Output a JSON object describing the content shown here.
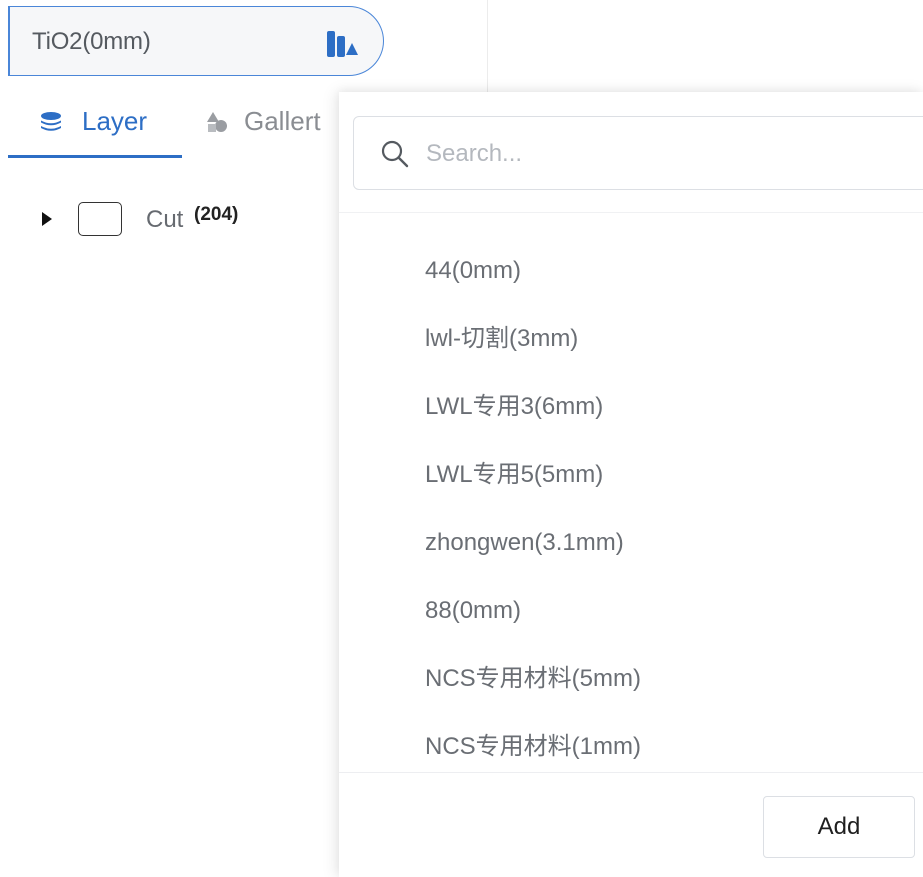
{
  "material_select": {
    "value": "TiO2(0mm)",
    "icon": "material-library-icon",
    "accent_color": "#2d6ec5"
  },
  "tabs": [
    {
      "label": "Layer",
      "icon": "layers-icon",
      "active": true
    },
    {
      "label": "Gallert",
      "icon": "shapes-icon",
      "active": false
    }
  ],
  "layer_tree": {
    "rows": [
      {
        "name": "Cut",
        "count": "(204)",
        "expand_icon": "caret-right-icon"
      }
    ]
  },
  "dropdown": {
    "search": {
      "placeholder": "Search...",
      "value": "",
      "icon": "search-icon"
    },
    "materials": [
      {
        "label": "44(0mm)"
      },
      {
        "label": "lwl-切割(3mm)"
      },
      {
        "label": "LWL专用3(6mm)"
      },
      {
        "label": "LWL专用5(5mm)"
      },
      {
        "label": "zhongwen(3.1mm)"
      },
      {
        "label": "88(0mm)"
      },
      {
        "label": "NCS专用材料(5mm)"
      },
      {
        "label": "NCS专用材料(1mm)"
      }
    ],
    "add_label": "Add"
  }
}
